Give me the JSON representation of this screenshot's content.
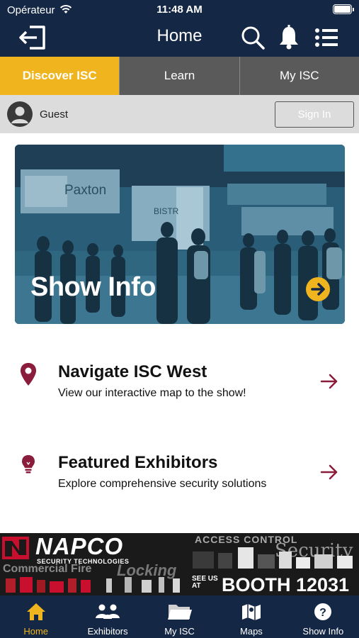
{
  "status_bar": {
    "carrier": "Opérateur",
    "time": "11:48 AM"
  },
  "nav": {
    "title": "Home"
  },
  "tabs": [
    {
      "label": "Discover ISC",
      "active": true
    },
    {
      "label": "Learn",
      "active": false
    },
    {
      "label": "My ISC",
      "active": false
    }
  ],
  "user": {
    "name": "Guest",
    "sign_in_label": "Sign In"
  },
  "hero": {
    "title": "Show Info",
    "background_signage": [
      "Paxton",
      "BISTR"
    ]
  },
  "features": [
    {
      "title": "Navigate ISC West",
      "subtitle": "View our interactive map to the show!",
      "icon": "map-pin-icon"
    },
    {
      "title": "Featured Exhibitors",
      "subtitle": "Explore comprehensive security solutions",
      "icon": "lightbulb-icon"
    }
  ],
  "ad": {
    "brand": "NAPCO",
    "tagline": "SECURITY TECHNOLOGIES",
    "category_fire": "Commercial Fire",
    "category_locking": "Locking",
    "category_access": "ACCESS CONTROL",
    "category_security": "Security",
    "see_us": "SEE US AT",
    "booth": "BOOTH 12031"
  },
  "bottom_tabs": [
    {
      "label": "Home",
      "icon": "home-icon",
      "active": true
    },
    {
      "label": "Exhibitors",
      "icon": "people-icon",
      "active": false
    },
    {
      "label": "My ISC",
      "icon": "folder-icon",
      "active": false
    },
    {
      "label": "Maps",
      "icon": "map-icon",
      "active": false
    },
    {
      "label": "Show Info",
      "icon": "question-icon",
      "active": false
    }
  ],
  "colors": {
    "navy": "#142744",
    "accent": "#f0b51e",
    "crimson": "#8a1c3c",
    "tab_inactive": "#5a5a5a"
  }
}
